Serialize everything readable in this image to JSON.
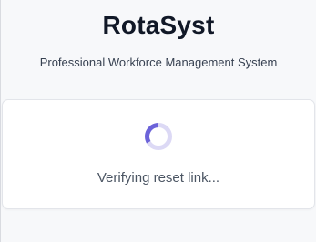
{
  "brand": {
    "title": "RotaSyst",
    "subtitle": "Professional Workforce Management System"
  },
  "status": {
    "message": "Verifying reset link..."
  },
  "icons": {
    "spinner": "loading-spinner-icon"
  },
  "colors": {
    "spinner_active": "#6c63d9",
    "spinner_track": "#dcd9f5",
    "title": "#111827",
    "background": "#f7f8fa",
    "card": "#ffffff"
  }
}
